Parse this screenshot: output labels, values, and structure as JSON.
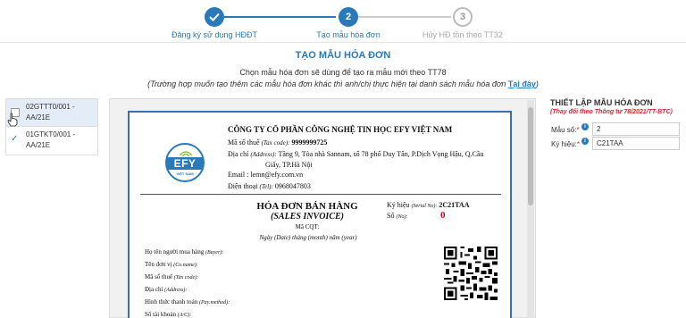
{
  "stepper": {
    "steps": [
      {
        "number": "",
        "label": "Đăng ký sử dụng HĐĐT",
        "state": "done"
      },
      {
        "number": "2",
        "label": "Tạo mẫu hóa đơn",
        "state": "active"
      },
      {
        "number": "3",
        "label": "Hủy HĐ tồn theo TT32",
        "state": "todo"
      }
    ]
  },
  "page": {
    "title": "TẠO MẪU HÓA ĐƠN",
    "subtitle": "Chọn mẫu hóa đơn sẽ dùng để tạo ra mẫu mới theo TT78",
    "note": "(Trường hợp muốn tạo thêm các mẫu hóa đơn khác thì anh/chị thực hiện tại danh sách mẫu hóa đơn",
    "note_link": "Tại đây",
    "note_end": ")"
  },
  "templates": [
    {
      "line1": "02GTTT0/001 -",
      "line2": "AA/21E",
      "selected": true
    },
    {
      "line1": "01GTKT0/001 -",
      "line2": "AA/21E",
      "selected": false
    }
  ],
  "invoice": {
    "company": "CÔNG TY CỔ PHẦN CÔNG NGHỆ TIN HỌC EFY VIỆT NAM",
    "tax_label": "Mã số thuế",
    "tax_label_en": "(Tax code):",
    "tax_code": "9999999725",
    "address_label": "Địa chỉ",
    "address_label_en": "(Address):",
    "address_line1": "Tầng 9, Tòa nhà Sannam, số 78 phố Duy Tân, P.Dịch Vọng Hậu, Q.Cầu",
    "address_line2": "Giấy, TP.Hà Nội",
    "email_label": "Email :",
    "email": "lemn@efy.com.vn",
    "phone_label": "Điện thoại",
    "phone_label_en": "(Tel):",
    "phone": "0968047803",
    "logo_text": "EFY",
    "logo_sub": "VIỆT NAM",
    "title": "HÓA ĐƠN BÁN HÀNG",
    "title_en": "(SALES INVOICE)",
    "cqt": "Mã CQT:",
    "date_line": "Ngày (Date)  tháng (month)  năm (year)",
    "serial_label": "Ký hiệu",
    "serial_label_en": "(Serial No):",
    "serial": "2C21TAA",
    "no_label": "Số",
    "no_label_en": "(No):",
    "no_value": "0",
    "buyer_fields": [
      {
        "vi": "Họ tên người mua hàng",
        "en": "(Buyer):"
      },
      {
        "vi": "Tên đơn vị",
        "en": "(Co.name):"
      },
      {
        "vi": "Mã số thuế",
        "en": "(Tax code):"
      },
      {
        "vi": "Địa chỉ",
        "en": "(Address):"
      },
      {
        "vi": "Hình thức thanh toán",
        "en": "(Pay.method):"
      },
      {
        "vi": "Số tài khoản",
        "en": "(A/C):"
      }
    ]
  },
  "settings": {
    "title": "THIẾT LẬP MẪU HÓA ĐƠN",
    "note": "(Thay đổi theo Thông tư 78/2021/TT-BTC)",
    "mau_so_label": "Mẫu số:",
    "mau_so_value": "2",
    "ky_hieu_label": "Ký hiệu:",
    "ky_hieu_value": "C21TAA",
    "required_mark": "*"
  },
  "colors": {
    "accent": "#2a7ab9",
    "required": "#d9232d",
    "invoice_number": "#e3001b",
    "paper_border": "#3d6db4"
  }
}
